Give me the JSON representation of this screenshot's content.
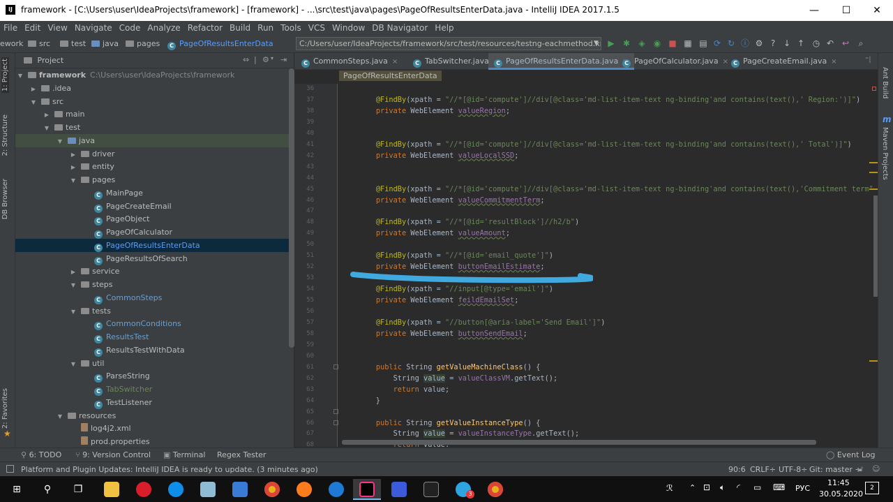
{
  "window": {
    "title": "framework - [C:\\Users\\user\\IdeaProjects\\framework] - [framework] - ...\\src\\test\\java\\pages\\PageOfResultsEnterData.java - IntelliJ IDEA 2017.1.5",
    "app_icon": "IJ",
    "minimize": "—",
    "maximize": "☐",
    "close": "✕"
  },
  "menu": [
    "File",
    "Edit",
    "View",
    "Navigate",
    "Code",
    "Analyze",
    "Refactor",
    "Build",
    "Run",
    "Tools",
    "VCS",
    "Window",
    "DB Navigator",
    "Help"
  ],
  "navbar": {
    "crumbs": [
      "ework",
      "src",
      "test",
      "java",
      "pages",
      "PageOfResultsEnterData"
    ],
    "path": "C:/Users/user/IdeaProjects/framework/src/test/resources/testng-eachmethod.xml"
  },
  "side_tools": {
    "left": [
      "1: Project",
      "2: Structure",
      "DB Browser",
      "2: Favorites"
    ],
    "right": [
      "Ant Build",
      "Maven Projects"
    ]
  },
  "project_panel": {
    "title": "Project",
    "tree": [
      {
        "label": "framework",
        "extra": "C:\\Users\\user\\IdeaProjects\\framework",
        "depth": 0,
        "arrow": "down",
        "kind": "folder"
      },
      {
        "label": ".idea",
        "depth": 1,
        "arrow": "right",
        "kind": "folder"
      },
      {
        "label": "src",
        "depth": 1,
        "arrow": "down",
        "kind": "folder"
      },
      {
        "label": "main",
        "depth": 2,
        "arrow": "right",
        "kind": "folder"
      },
      {
        "label": "test",
        "depth": 2,
        "arrow": "down",
        "kind": "folder"
      },
      {
        "label": "java",
        "depth": 3,
        "arrow": "down",
        "kind": "folder-green"
      },
      {
        "label": "driver",
        "depth": 4,
        "arrow": "right",
        "kind": "folder"
      },
      {
        "label": "entity",
        "depth": 4,
        "arrow": "right",
        "kind": "folder"
      },
      {
        "label": "pages",
        "depth": 4,
        "arrow": "down",
        "kind": "folder"
      },
      {
        "label": "MainPage",
        "depth": 5,
        "kind": "class"
      },
      {
        "label": "PageCreateEmail",
        "depth": 5,
        "kind": "class"
      },
      {
        "label": "PageObject",
        "depth": 5,
        "kind": "class"
      },
      {
        "label": "PageOfCalculator",
        "depth": 5,
        "kind": "class"
      },
      {
        "label": "PageOfResultsEnterData",
        "depth": 5,
        "kind": "class",
        "style": "selected"
      },
      {
        "label": "PageResultsOfSearch",
        "depth": 5,
        "kind": "class"
      },
      {
        "label": "service",
        "depth": 4,
        "arrow": "right",
        "kind": "folder"
      },
      {
        "label": "steps",
        "depth": 4,
        "arrow": "down",
        "kind": "folder"
      },
      {
        "label": "CommonSteps",
        "depth": 5,
        "kind": "class",
        "style": "teal"
      },
      {
        "label": "tests",
        "depth": 4,
        "arrow": "down",
        "kind": "folder"
      },
      {
        "label": "CommonConditions",
        "depth": 5,
        "kind": "class",
        "style": "teal"
      },
      {
        "label": "ResultsTest",
        "depth": 5,
        "kind": "class",
        "style": "teal"
      },
      {
        "label": "ResultsTestWithData",
        "depth": 5,
        "kind": "class"
      },
      {
        "label": "util",
        "depth": 4,
        "arrow": "down",
        "kind": "folder"
      },
      {
        "label": "ParseString",
        "depth": 5,
        "kind": "class"
      },
      {
        "label": "TabSwitcher",
        "depth": 5,
        "kind": "class",
        "style": "green"
      },
      {
        "label": "TestListener",
        "depth": 5,
        "kind": "class"
      },
      {
        "label": "resources",
        "depth": 3,
        "arrow": "down",
        "kind": "folder"
      },
      {
        "label": "log4j2.xml",
        "depth": 4,
        "kind": "file"
      },
      {
        "label": "prod.properties",
        "depth": 4,
        "kind": "file"
      }
    ]
  },
  "editor_tabs": [
    {
      "label": "CommonSteps.java",
      "active": false
    },
    {
      "label": "TabSwitcher.java",
      "active": false
    },
    {
      "label": "PageOfResultsEnterData.java",
      "active": true
    },
    {
      "label": "PageOfCalculator.java",
      "active": false
    },
    {
      "label": "PageCreateEmail.java",
      "active": false
    }
  ],
  "editor_breadcrumb": "PageOfResultsEnterData",
  "code_lines": [
    {
      "n": "36",
      "html": ""
    },
    {
      "n": "37",
      "html": "    <span class='ann'>@FindBy</span>(xpath = <span class='str'>\"//*[@id='compute']//div[@class='md-list-item-text ng-binding'and contains(text(),' Region:')]\"</span>)"
    },
    {
      "n": "38",
      "html": "    <span class='kw'>private</span> WebElement <span class='fld'>valueRegion</span>;"
    },
    {
      "n": "39",
      "html": ""
    },
    {
      "n": "40",
      "html": ""
    },
    {
      "n": "41",
      "html": "    <span class='ann'>@FindBy</span>(xpath = <span class='str'>\"//*[@id='compute']//div[@class='md-list-item-text ng-binding'and contains(text(),' Total')]\"</span>)"
    },
    {
      "n": "42",
      "html": "    <span class='kw'>private</span> WebElement <span class='fld'>valueLocalSSD</span>;"
    },
    {
      "n": "43",
      "html": ""
    },
    {
      "n": "44",
      "html": ""
    },
    {
      "n": "45",
      "html": "    <span class='ann'>@FindBy</span>(xpath = <span class='str'>\"//*[@id='compute']//div[@class='md-list-item-text ng-binding'and contains(text(),'Commitment term\"</span>"
    },
    {
      "n": "46",
      "html": "    <span class='kw'>private</span> WebElement <span class='fld'>valueCommitmentTerm</span>;"
    },
    {
      "n": "47",
      "html": ""
    },
    {
      "n": "48",
      "html": "    <span class='ann'>@FindBy</span>(xpath = <span class='str'>\"//*[@id='resultBlock']//h2/b\"</span>)"
    },
    {
      "n": "49",
      "html": "    <span class='kw'>private</span> WebElement <span class='fld'>valueAmount</span>;"
    },
    {
      "n": "50",
      "html": ""
    },
    {
      "n": "51",
      "html": "    <span class='ann'>@FindBy</span>(xpath = <span class='str'>\"//*[@id='email_quote']\"</span>)"
    },
    {
      "n": "52",
      "html": "    <span class='kw'>private</span> WebElement <span class='fld'>buttonEmailEstimate</span>;"
    },
    {
      "n": "53",
      "html": ""
    },
    {
      "n": "54",
      "html": "    <span class='ann'>@FindBy</span>(xpath = <span class='str'>\"//input[@type='email']\"</span>)"
    },
    {
      "n": "55",
      "html": "    <span class='kw'>private</span> WebElement <span class='fld'>feildEmailSet</span>;"
    },
    {
      "n": "56",
      "html": ""
    },
    {
      "n": "57",
      "html": "    <span class='ann'>@FindBy</span>(xpath = <span class='str'>\"//button[@aria-label='Send Email']\"</span>)"
    },
    {
      "n": "58",
      "html": "    <span class='kw'>private</span> WebElement <span class='fld'>buttonSendEmail</span>;"
    },
    {
      "n": "59",
      "html": ""
    },
    {
      "n": "60",
      "html": ""
    },
    {
      "n": "61",
      "html": "    <span class='kw'>public</span> String <span class='fn'>getValueMachineClass</span>() {"
    },
    {
      "n": "62",
      "html": "        String <span class='var'>value</span> = <span class='fld' style='text-decoration:none'>valueClassVM</span>.getText();"
    },
    {
      "n": "63",
      "html": "        <span class='kw'>return</span> value;"
    },
    {
      "n": "64",
      "html": "    }"
    },
    {
      "n": "65",
      "html": ""
    },
    {
      "n": "66",
      "html": "    <span class='kw'>public</span> String <span class='fn'>getValueInstanceType</span>() {"
    },
    {
      "n": "67",
      "html": "        String <span class='var'>value</span> = <span class='fld' style='text-decoration:none'>valueInstanceType</span>.getText();"
    },
    {
      "n": "68",
      "html": "        <span class='kw'>return</span> value;"
    }
  ],
  "bottom_tools": [
    "6: TODO",
    "9: Version Control",
    "Terminal",
    "Regex Tester",
    "Event Log"
  ],
  "status": {
    "message": "Platform and Plugin Updates: IntelliJ IDEA is ready to update. (3 minutes ago)",
    "position": "90:6",
    "line_sep": "CRLF÷",
    "encoding": "UTF-8÷",
    "git": "Git: master ÷"
  },
  "taskbar": {
    "lang": "РУС",
    "time": "11:45",
    "date": "30.05.2020",
    "notif_count": "2",
    "badge": "3"
  },
  "colors": {
    "accent": "#4a88c7",
    "highlight_stroke": "#3fa9e0"
  }
}
